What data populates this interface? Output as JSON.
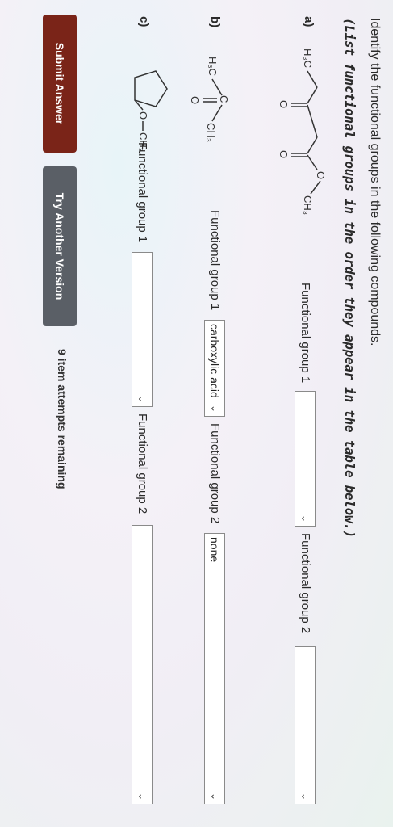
{
  "question": {
    "instruction": "Identify the functional groups in the following compounds.",
    "subinstruction": "(List functional groups in the order they appear in the table below.)"
  },
  "compounds": [
    {
      "label": "a)",
      "fg1_label": "Functional group 1",
      "fg1_value": "",
      "fg2_label": "Functional group 2",
      "fg2_value": ""
    },
    {
      "label": "b)",
      "fg1_label": "Functional group 1",
      "fg1_value": "carboxylic acid",
      "fg2_label": "Functional group 2",
      "fg2_value": "none"
    },
    {
      "label": "c)",
      "fg1_label": "Functional group 1",
      "fg1_value": "",
      "fg2_label": "Functional group 2",
      "fg2_value": ""
    }
  ],
  "structures": {
    "a": {
      "methyl_left": "H₃C",
      "oxo1": "O",
      "oxo2": "O",
      "ester_o": "O",
      "methyl_right": "CH₃"
    },
    "b": {
      "methyl_left": "H₃C",
      "carbon": "C",
      "oxo": "O",
      "methyl_right": "CH₃"
    },
    "c": {
      "ether_o": "O",
      "methyl": "CH₃"
    }
  },
  "actions": {
    "submit_label": "Submit Answer",
    "try_label": "Try Another Version",
    "remaining_text": "9 item attempts remaining"
  },
  "colors": {
    "submit_bg": "#7a2418",
    "try_bg": "#5a5f66"
  }
}
